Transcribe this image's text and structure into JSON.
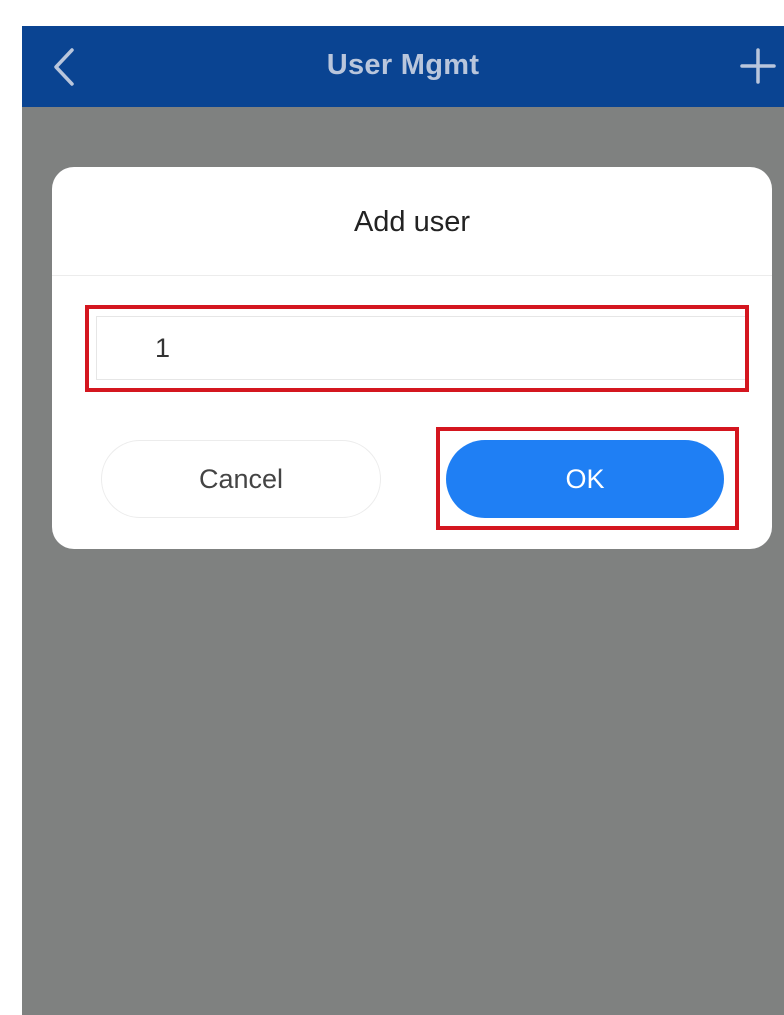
{
  "header": {
    "title": "User Mgmt",
    "back_icon": "chevron-left-icon",
    "add_icon": "plus-icon"
  },
  "dialog": {
    "title": "Add user",
    "input_value": "1",
    "cancel_label": "Cancel",
    "ok_label": "OK"
  },
  "colors": {
    "header_bg": "#0a4492",
    "overlay": "#7f8180",
    "ok_button": "#1f7ff4",
    "highlight": "#d4161f"
  }
}
